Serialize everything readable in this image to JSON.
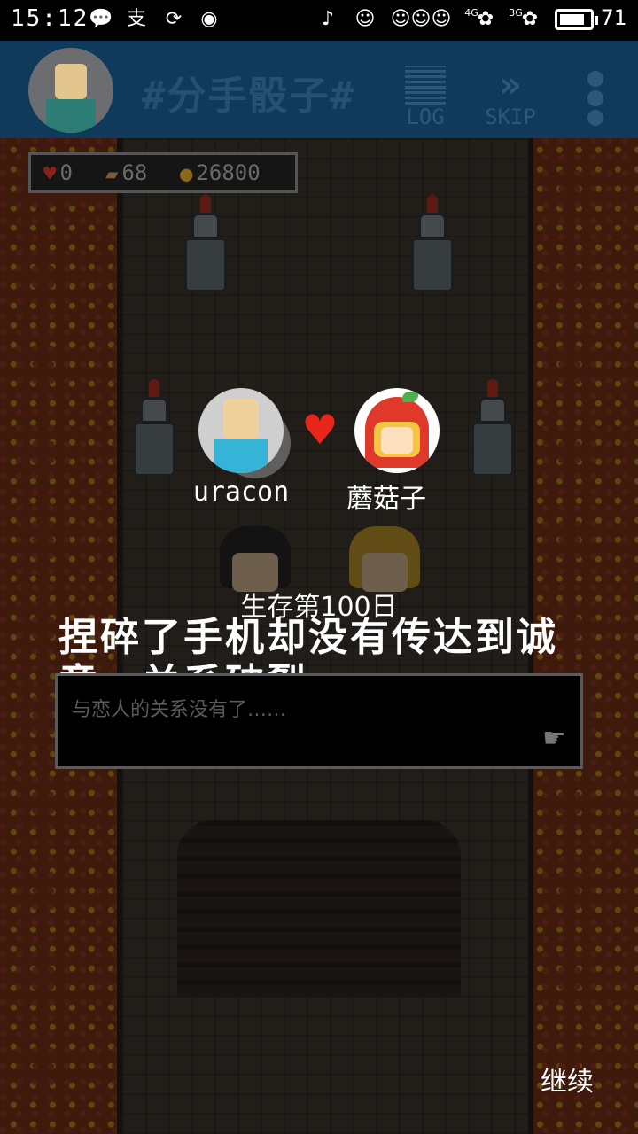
{
  "status_bar": {
    "time": "15:12",
    "battery_level": "71",
    "network_labels": [
      "4G",
      "3G"
    ]
  },
  "top_bar": {
    "title": "#分手骰子#",
    "log_label": "LOG",
    "skip_label": "SKIP"
  },
  "stats": {
    "hearts": "0",
    "items": "68",
    "coins": "26800"
  },
  "couple": {
    "left_name": "uracon",
    "right_name": "蘑菇子"
  },
  "result": {
    "survival_day": "生存第100日",
    "ending_text": "捏碎了手机却没有传达到诚意，关系破裂"
  },
  "dialog": {
    "text": "与恋人的关系没有了……"
  },
  "continue_label": "继续",
  "colors": {
    "top_bar_bg": "#0f3a5c",
    "heart": "#e8261c",
    "coin": "#d4a12a"
  }
}
